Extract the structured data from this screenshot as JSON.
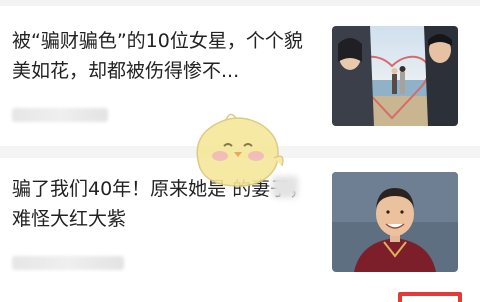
{
  "feed": {
    "items": [
      {
        "title": "被“骗财骗色”的10位女星，个个貌美如花，却都被伤得惨不..."
      },
      {
        "title": "骗了我们40年！原来她是 的妻子，难怪大红大紫"
      }
    ]
  },
  "colors": {
    "accent_red": "#e53935",
    "divider": "#f4f4f4",
    "mascot_yellow": "#f5e79a"
  },
  "icons": {
    "mascot": "chick-mascot-watermark"
  }
}
